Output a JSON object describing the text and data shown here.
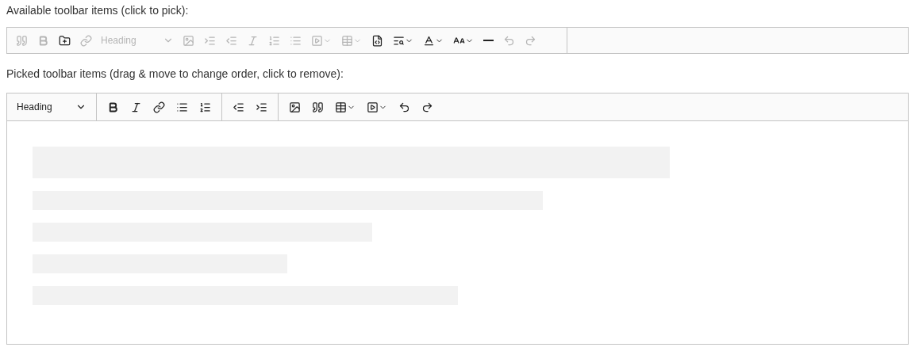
{
  "available": {
    "label": "Available toolbar items (click to pick):",
    "items": [
      {
        "kind": "quote",
        "picked": true
      },
      {
        "kind": "bold",
        "picked": true
      },
      {
        "kind": "folder",
        "picked": false
      },
      {
        "kind": "link",
        "picked": true
      },
      {
        "kind": "heading",
        "text": "Heading",
        "picked": true
      },
      {
        "kind": "image",
        "picked": true
      },
      {
        "kind": "indent",
        "picked": true
      },
      {
        "kind": "outdent",
        "picked": true
      },
      {
        "kind": "italic",
        "picked": true
      },
      {
        "kind": "numbered",
        "picked": true
      },
      {
        "kind": "bulleted",
        "picked": true
      },
      {
        "kind": "media",
        "picked": true
      },
      {
        "kind": "table",
        "picked": true
      },
      {
        "kind": "source",
        "picked": false
      },
      {
        "kind": "find",
        "picked": false
      },
      {
        "kind": "fontcolor",
        "picked": false
      },
      {
        "kind": "fontsize",
        "picked": false
      },
      {
        "kind": "hline",
        "picked": false
      },
      {
        "kind": "undo",
        "picked": true
      },
      {
        "kind": "redo",
        "picked": true
      }
    ]
  },
  "picked": {
    "label": "Picked toolbar items (drag & move to change order, click to remove):",
    "groups": [
      [
        {
          "kind": "heading",
          "text": "Heading"
        }
      ],
      [
        {
          "kind": "bold"
        },
        {
          "kind": "italic"
        },
        {
          "kind": "link"
        },
        {
          "kind": "bulleted"
        },
        {
          "kind": "numbered"
        }
      ],
      [
        {
          "kind": "outdent"
        },
        {
          "kind": "indent"
        }
      ],
      [
        {
          "kind": "image"
        },
        {
          "kind": "quote"
        },
        {
          "kind": "table"
        },
        {
          "kind": "media"
        },
        {
          "kind": "undo"
        },
        {
          "kind": "redo"
        }
      ]
    ]
  }
}
